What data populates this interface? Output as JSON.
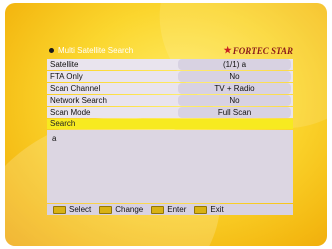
{
  "header": {
    "title": "Multi Satellite Search",
    "brand": "FORTEC STAR"
  },
  "settings": [
    {
      "label": "Satellite",
      "value": "(1/1) a"
    },
    {
      "label": "FTA Only",
      "value": "No"
    },
    {
      "label": "Scan Channel",
      "value": "TV + Radio"
    },
    {
      "label": "Network Search",
      "value": "No"
    },
    {
      "label": "Scan Mode",
      "value": "Full Scan"
    }
  ],
  "search": {
    "label": "Search",
    "results": [
      "a"
    ]
  },
  "footer": [
    {
      "icon": "key-icon",
      "label": "Select"
    },
    {
      "icon": "key-icon",
      "label": "Change"
    },
    {
      "icon": "key-icon",
      "label": "Enter"
    },
    {
      "icon": "key-icon",
      "label": "Exit"
    }
  ],
  "colors": {
    "highlight": "#f7ea20",
    "background": "#fbd62e",
    "brand": "#8a1a1a"
  }
}
